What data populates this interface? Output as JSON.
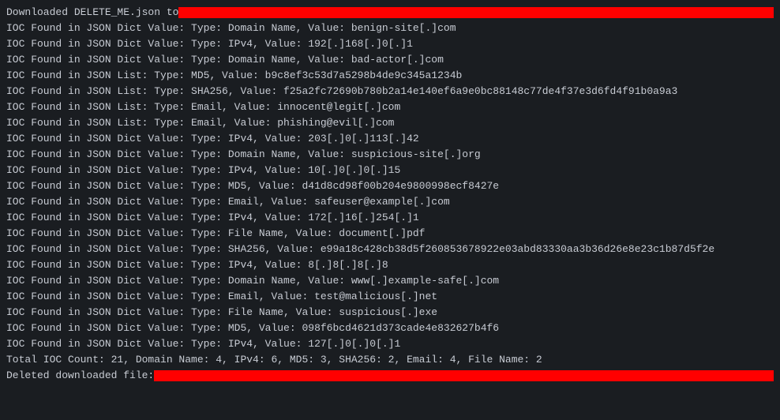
{
  "download_line_prefix": "Downloaded DELETE_ME.json to",
  "redact1_width": 764,
  "ioc_lines": [
    "IOC Found in JSON Dict Value: Type: Domain Name, Value: benign-site[.]com",
    "IOC Found in JSON Dict Value: Type: IPv4, Value: 192[.]168[.]0[.]1",
    "IOC Found in JSON Dict Value: Type: Domain Name, Value: bad-actor[.]com",
    "IOC Found in JSON List: Type: MD5, Value: b9c8ef3c53d7a5298b4de9c345a1234b",
    "IOC Found in JSON List: Type: SHA256, Value: f25a2fc72690b780b2a14e140ef6a9e0bc88148c77de4f37e3d6fd4f91b0a9a3",
    "IOC Found in JSON List: Type: Email, Value: innocent@legit[.]com",
    "IOC Found in JSON List: Type: Email, Value: phishing@evil[.]com",
    "IOC Found in JSON Dict Value: Type: IPv4, Value: 203[.]0[.]113[.]42",
    "IOC Found in JSON Dict Value: Type: Domain Name, Value: suspicious-site[.]org",
    "IOC Found in JSON Dict Value: Type: IPv4, Value: 10[.]0[.]0[.]15",
    "IOC Found in JSON Dict Value: Type: MD5, Value: d41d8cd98f00b204e9800998ecf8427e",
    "IOC Found in JSON Dict Value: Type: Email, Value: safeuser@example[.]com",
    "IOC Found in JSON Dict Value: Type: IPv4, Value: 172[.]16[.]254[.]1",
    "IOC Found in JSON Dict Value: Type: File Name, Value: document[.]pdf",
    "IOC Found in JSON Dict Value: Type: SHA256, Value: e99a18c428cb38d5f260853678922e03abd83330aa3b36d26e8e23c1b87d5f2e",
    "IOC Found in JSON Dict Value: Type: IPv4, Value: 8[.]8[.]8[.]8",
    "IOC Found in JSON Dict Value: Type: Domain Name, Value: www[.]example-safe[.]com",
    "IOC Found in JSON Dict Value: Type: Email, Value: test@malicious[.]net",
    "IOC Found in JSON Dict Value: Type: File Name, Value: suspicious[.]exe",
    "IOC Found in JSON Dict Value: Type: MD5, Value: 098f6bcd4621d373cade4e832627b4f6",
    "IOC Found in JSON Dict Value: Type: IPv4, Value: 127[.]0[.]0[.]1"
  ],
  "total_line": "Total IOC Count: 21, Domain Name: 4, IPv4: 6, MD5: 3, SHA256: 2, Email: 4, File Name: 2",
  "deleted_line_prefix": "Deleted downloaded file:",
  "redact2_width": 800
}
